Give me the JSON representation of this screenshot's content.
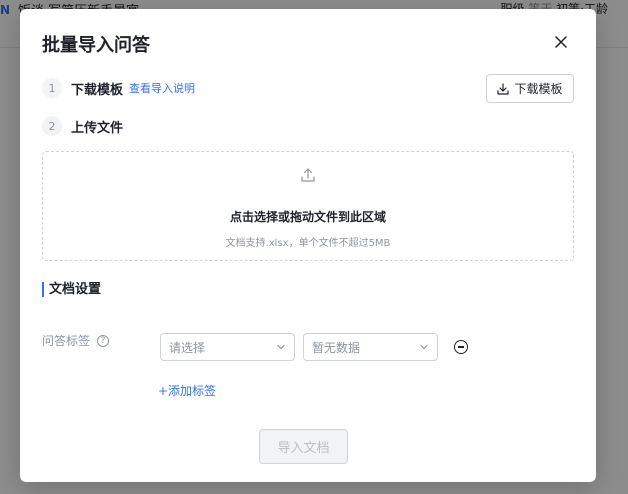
{
  "background": {
    "logo": "N",
    "title": "饭谈 写简历新手暑宴",
    "subtitle": "",
    "right_prefix": "职级",
    "right_muted": "等于",
    "right_value": "初等·工龄"
  },
  "modal": {
    "title": "批量导入问答",
    "close_icon": "close-icon",
    "steps": [
      {
        "num": "1",
        "label": "下载模板",
        "link": "查看导入说明"
      },
      {
        "num": "2",
        "label": "上传文件"
      }
    ],
    "download_button": "下载模板",
    "dropzone": {
      "icon": "upload-icon",
      "main_text": "点击选择或拖动文件到此区域",
      "hint": "文档支持.xlsx，单个文件不超过5MB"
    },
    "section_title": "文档设置",
    "tag_field": {
      "label": "问答标签",
      "select_1_placeholder": "请选择",
      "select_2_placeholder": "暂无数据",
      "add_label": "+添加标签"
    },
    "import_button": "导入文档"
  },
  "colors": {
    "accent": "#3370ff",
    "text": "#1f2329",
    "muted": "#8f959e",
    "border": "#d0d3d6"
  }
}
